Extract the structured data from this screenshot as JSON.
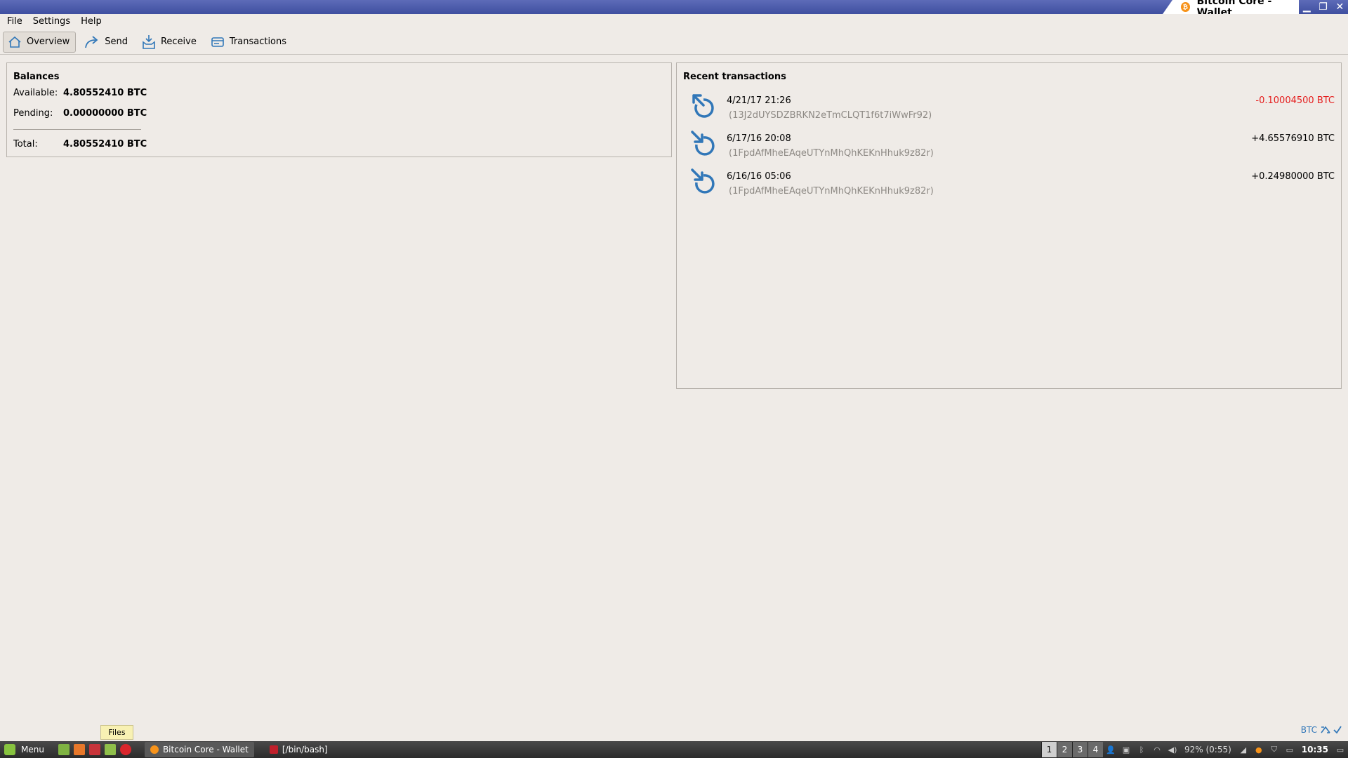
{
  "window": {
    "title": "Bitcoin Core - Wallet"
  },
  "menu": [
    "File",
    "Settings",
    "Help"
  ],
  "toolbar": {
    "overview": "Overview",
    "send": "Send",
    "receive": "Receive",
    "transactions": "Transactions"
  },
  "balances": {
    "title": "Balances",
    "available_label": "Available:",
    "available_value": "4.80552410 BTC",
    "pending_label": "Pending:",
    "pending_value": "0.00000000 BTC",
    "total_label": "Total:",
    "total_value": "4.80552410 BTC"
  },
  "recent": {
    "title": "Recent transactions",
    "items": [
      {
        "date": "4/21/17 21:26",
        "address": "(13J2dUYSDZBRKN2eTmCLQT1f6t7iWwFr92)",
        "amount": "-0.10004500 BTC",
        "type": "sent"
      },
      {
        "date": "6/17/16 20:08",
        "address": "(1FpdAfMheEAqeUTYnMhQhKEKnHhuk9z82r)",
        "amount": "+4.65576910 BTC",
        "type": "received"
      },
      {
        "date": "6/16/16 05:06",
        "address": "(1FpdAfMheEAqeUTYnMhQhKEKnHhuk9z82r)",
        "amount": "+0.24980000 BTC",
        "type": "received"
      }
    ]
  },
  "statusbar": {
    "unit": "BTC"
  },
  "tooltip": {
    "text": "Files"
  },
  "taskbar": {
    "menu_label": "Menu",
    "tasks": [
      "Bitcoin Core - Wallet",
      "[/bin/bash]"
    ],
    "workspaces": [
      "1",
      "2",
      "3",
      "4"
    ],
    "battery": "92% (0:55)",
    "clock": "10:35"
  },
  "colors": {
    "accent": "#3177b8",
    "negative": "#e51d1d",
    "bitcoin": "#f7931a"
  }
}
